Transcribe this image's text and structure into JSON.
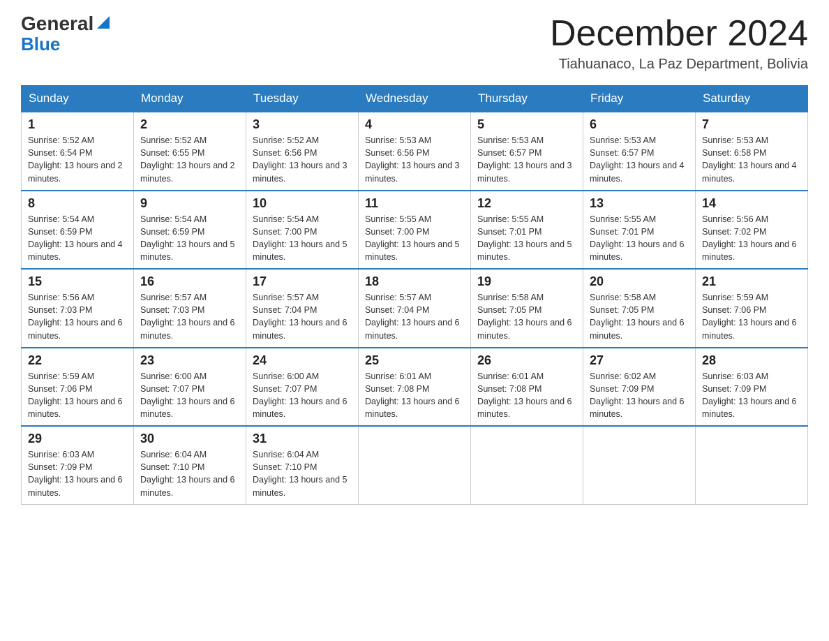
{
  "header": {
    "logo_general": "General",
    "logo_blue": "Blue",
    "month_title": "December 2024",
    "location": "Tiahuanaco, La Paz Department, Bolivia"
  },
  "days_of_week": [
    "Sunday",
    "Monday",
    "Tuesday",
    "Wednesday",
    "Thursday",
    "Friday",
    "Saturday"
  ],
  "weeks": [
    [
      {
        "num": "1",
        "sunrise": "5:52 AM",
        "sunset": "6:54 PM",
        "daylight": "13 hours and 2 minutes."
      },
      {
        "num": "2",
        "sunrise": "5:52 AM",
        "sunset": "6:55 PM",
        "daylight": "13 hours and 2 minutes."
      },
      {
        "num": "3",
        "sunrise": "5:52 AM",
        "sunset": "6:56 PM",
        "daylight": "13 hours and 3 minutes."
      },
      {
        "num": "4",
        "sunrise": "5:53 AM",
        "sunset": "6:56 PM",
        "daylight": "13 hours and 3 minutes."
      },
      {
        "num": "5",
        "sunrise": "5:53 AM",
        "sunset": "6:57 PM",
        "daylight": "13 hours and 3 minutes."
      },
      {
        "num": "6",
        "sunrise": "5:53 AM",
        "sunset": "6:57 PM",
        "daylight": "13 hours and 4 minutes."
      },
      {
        "num": "7",
        "sunrise": "5:53 AM",
        "sunset": "6:58 PM",
        "daylight": "13 hours and 4 minutes."
      }
    ],
    [
      {
        "num": "8",
        "sunrise": "5:54 AM",
        "sunset": "6:59 PM",
        "daylight": "13 hours and 4 minutes."
      },
      {
        "num": "9",
        "sunrise": "5:54 AM",
        "sunset": "6:59 PM",
        "daylight": "13 hours and 5 minutes."
      },
      {
        "num": "10",
        "sunrise": "5:54 AM",
        "sunset": "7:00 PM",
        "daylight": "13 hours and 5 minutes."
      },
      {
        "num": "11",
        "sunrise": "5:55 AM",
        "sunset": "7:00 PM",
        "daylight": "13 hours and 5 minutes."
      },
      {
        "num": "12",
        "sunrise": "5:55 AM",
        "sunset": "7:01 PM",
        "daylight": "13 hours and 5 minutes."
      },
      {
        "num": "13",
        "sunrise": "5:55 AM",
        "sunset": "7:01 PM",
        "daylight": "13 hours and 6 minutes."
      },
      {
        "num": "14",
        "sunrise": "5:56 AM",
        "sunset": "7:02 PM",
        "daylight": "13 hours and 6 minutes."
      }
    ],
    [
      {
        "num": "15",
        "sunrise": "5:56 AM",
        "sunset": "7:03 PM",
        "daylight": "13 hours and 6 minutes."
      },
      {
        "num": "16",
        "sunrise": "5:57 AM",
        "sunset": "7:03 PM",
        "daylight": "13 hours and 6 minutes."
      },
      {
        "num": "17",
        "sunrise": "5:57 AM",
        "sunset": "7:04 PM",
        "daylight": "13 hours and 6 minutes."
      },
      {
        "num": "18",
        "sunrise": "5:57 AM",
        "sunset": "7:04 PM",
        "daylight": "13 hours and 6 minutes."
      },
      {
        "num": "19",
        "sunrise": "5:58 AM",
        "sunset": "7:05 PM",
        "daylight": "13 hours and 6 minutes."
      },
      {
        "num": "20",
        "sunrise": "5:58 AM",
        "sunset": "7:05 PM",
        "daylight": "13 hours and 6 minutes."
      },
      {
        "num": "21",
        "sunrise": "5:59 AM",
        "sunset": "7:06 PM",
        "daylight": "13 hours and 6 minutes."
      }
    ],
    [
      {
        "num": "22",
        "sunrise": "5:59 AM",
        "sunset": "7:06 PM",
        "daylight": "13 hours and 6 minutes."
      },
      {
        "num": "23",
        "sunrise": "6:00 AM",
        "sunset": "7:07 PM",
        "daylight": "13 hours and 6 minutes."
      },
      {
        "num": "24",
        "sunrise": "6:00 AM",
        "sunset": "7:07 PM",
        "daylight": "13 hours and 6 minutes."
      },
      {
        "num": "25",
        "sunrise": "6:01 AM",
        "sunset": "7:08 PM",
        "daylight": "13 hours and 6 minutes."
      },
      {
        "num": "26",
        "sunrise": "6:01 AM",
        "sunset": "7:08 PM",
        "daylight": "13 hours and 6 minutes."
      },
      {
        "num": "27",
        "sunrise": "6:02 AM",
        "sunset": "7:09 PM",
        "daylight": "13 hours and 6 minutes."
      },
      {
        "num": "28",
        "sunrise": "6:03 AM",
        "sunset": "7:09 PM",
        "daylight": "13 hours and 6 minutes."
      }
    ],
    [
      {
        "num": "29",
        "sunrise": "6:03 AM",
        "sunset": "7:09 PM",
        "daylight": "13 hours and 6 minutes."
      },
      {
        "num": "30",
        "sunrise": "6:04 AM",
        "sunset": "7:10 PM",
        "daylight": "13 hours and 6 minutes."
      },
      {
        "num": "31",
        "sunrise": "6:04 AM",
        "sunset": "7:10 PM",
        "daylight": "13 hours and 5 minutes."
      },
      null,
      null,
      null,
      null
    ]
  ]
}
